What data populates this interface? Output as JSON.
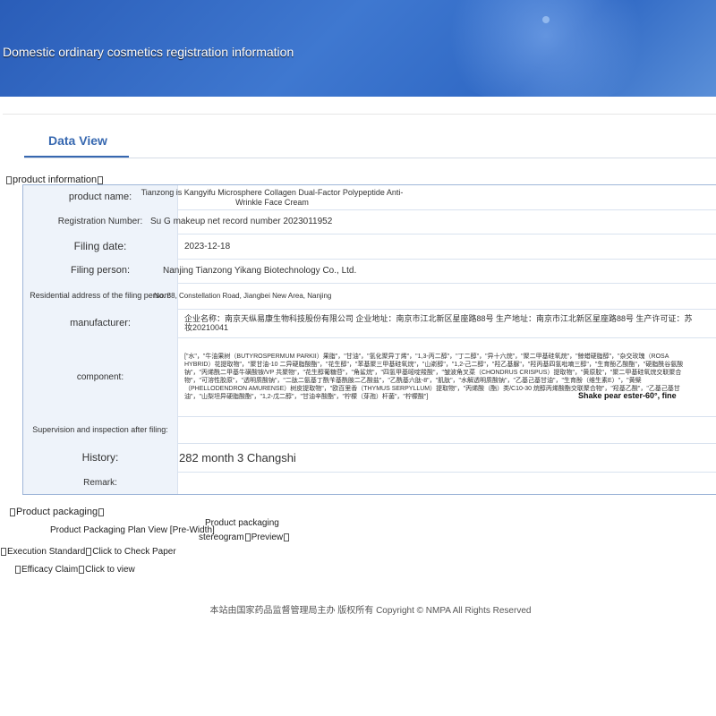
{
  "page": {
    "banner_title": "Domestic ordinary cosmetics registration information"
  },
  "tabs": {
    "active": "Data View"
  },
  "sections": {
    "product_info": "product information",
    "packaging": "Product packaging"
  },
  "fields": [
    {
      "label": "product name:",
      "value": "Tianzong is Kangyifu Microsphere Collagen Dual-Factor Polypeptide Anti-Wrinkle Face Cream"
    },
    {
      "label": "Registration Number:",
      "value": "Su G makeup net record number 2023011952"
    },
    {
      "label": "Filing date:",
      "value": "2023-12-18"
    },
    {
      "label": "Filing person:",
      "value": "Nanjing Tianzong Yikang Biotechnology Co., Ltd."
    },
    {
      "label": "Residential address of the filing person:",
      "value": "No. 88, Constellation Road, Jiangbei New Area, Nanjing"
    },
    {
      "label": "manufacturer:",
      "value": "企业名称：南京天纵易康生物科技股份有限公司 企业地址：南京市江北新区星座路88号 生产地址：南京市江北新区星座路88号 生产许可证：苏妆20210041"
    },
    {
      "label": "component:",
      "value": "[\"水\"，\"牛油果树（BUTYROSPERMUM PARKII）果脂\"，\"甘油\"，\"氢化聚异丁烯\"，\"1,3-丙二醇\"，\"丁二醇\"，\"异十六烷\"，\"聚二甲基硅氧烷\"，\"鲸蜡硬脂醇\"，\"杂交玫瑰（ROSA HYBRID）花提取物\"，\"聚甘油-10 二异硬脂酸酯\"，\"花生醇\"，\"苯基聚三甲基硅氧烷\"，\"山嵛醇\"，\"1,2-己二醇\"，\"羟乙基脲\"，\"羟丙基四氢吡喃三醇\"，\"生育酚乙酸酯\"，\"硬脂酰谷氨酸钠\"，\"丙烯酰二甲基牛磺酸铵/VP 共聚物\"，\"花生醇葡糖苷\"，\"角鲨烷\"，\"四氢甲基嘧啶羧酸\"，\"皱波角叉菜（CHONDRUS CRISPUS）提取物\"，\"黄原胶\"，\"聚二甲基硅氧烷交联聚合物\"，\"可溶性胶原\"，\"透明质酸钠\"，\"二肽二氨基丁酰苄基酰胺二乙酸盐\"，\"乙酰基六肽-8\"，\"肌肽\"，\"水解透明质酸钠\"，\"乙基己基甘油\"，\"生育酚（维生素E）\"，\"黄檗（PHELLODENDRON AMURENSE）树皮提取物\"，\"欧百里香（THYMUS SERPYLLUM）提取物\"，\"丙烯酸（酯）类/C10-30 烷醇丙烯酸酯交联聚合物\"，\"羟基乙酸\"，\"乙基己基甘油\"，\"山梨坦异硬脂酸酯\"，\"1,2-戊二醇\"，\"甘油辛酸酯\"，\"柠檬（芽孢）杆菌\"，\"柠檬酸\"]",
      "overlay": "Shake pear ester-60°, fine"
    },
    {
      "label": "Supervision and inspection after filing:",
      "value": ""
    },
    {
      "label": "History:",
      "value": "282 month 3 Changshi"
    },
    {
      "label": "Remark:",
      "value": ""
    }
  ],
  "packaging": {
    "plan_view": "Product Packaging Plan View [Pre-Width]",
    "stereogram_line1": "Product packaging",
    "stereogram_line2": "stereogram",
    "preview": "Preview",
    "execution_standard": "Execution Standard",
    "check_paper": "Click to Check Paper",
    "efficacy_claim": "Efficacy Claim",
    "click_view": "Click to view"
  },
  "footer": {
    "text": "本站由国家药品监督管理局主办 版权所有 Copyright © NMPA All Rights Reserved"
  }
}
